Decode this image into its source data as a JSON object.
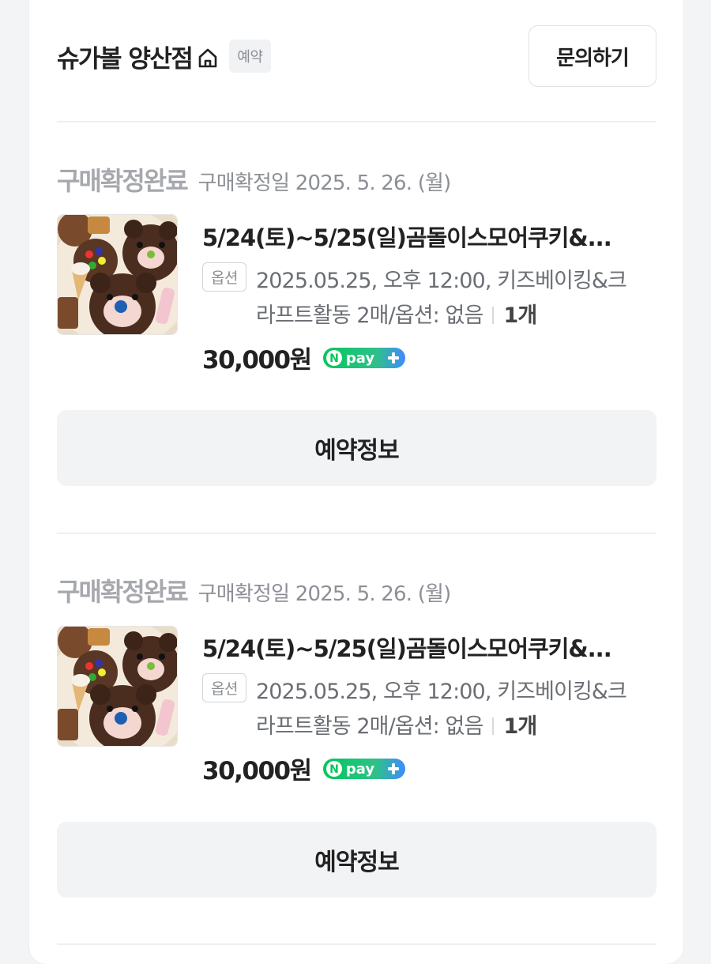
{
  "store": {
    "name": "슈가볼 양산점",
    "badge": "예약",
    "inquiry_label": "문의하기"
  },
  "orders": [
    {
      "status": "구매확정완료",
      "confirm_date": "구매확정일 2025. 5. 26. (월)",
      "title": "5/24(토)~5/25(일)곰돌이스모어쿠키&...",
      "option_tag": "옵션",
      "option_line1": "2025.05.25, 오후 12:00, 키즈베이킹&크",
      "option_line2": "라프트활동 2매/옵션: 없음",
      "quantity": "1개",
      "price": "30,000원",
      "npay_text": "pay",
      "action_label": "예약정보"
    },
    {
      "status": "구매확정완료",
      "confirm_date": "구매확정일 2025. 5. 26. (월)",
      "title": "5/24(토)~5/25(일)곰돌이스모어쿠키&...",
      "option_tag": "옵션",
      "option_line1": "2025.05.25, 오후 12:00, 키즈베이킹&크",
      "option_line2": "라프트활동 2매/옵션: 없음",
      "quantity": "1개",
      "price": "30,000원",
      "npay_text": "pay",
      "action_label": "예약정보"
    }
  ],
  "colors": {
    "status_gray": "#a6a8ad",
    "npay_green": "#03c75a",
    "npay_blue": "#3d8bff"
  },
  "icons": [
    "home-icon",
    "npay-plus-icon"
  ]
}
